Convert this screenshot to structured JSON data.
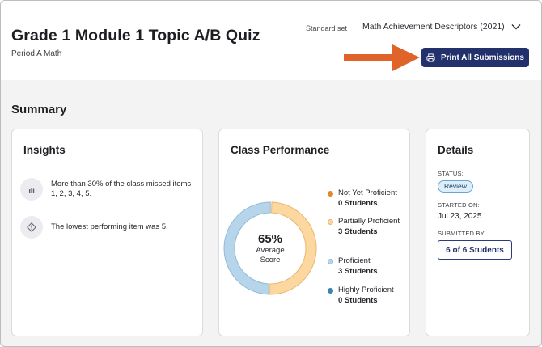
{
  "header": {
    "title": "Grade 1 Module 1 Topic A/B Quiz",
    "subtitle": "Period A Math",
    "standard_set_label": "Standard set",
    "standard_set_value": "Math Achievement Descriptors (2021)",
    "print_button_label": "Print All Submissions",
    "arrow_color": "#e0642a"
  },
  "summary": {
    "heading": "Summary"
  },
  "insights": {
    "title": "Insights",
    "items": [
      {
        "icon": "bar-chart-icon",
        "text": "More than 30% of the class missed items 1, 2, 3, 4, 5."
      },
      {
        "icon": "warning-diamond-icon",
        "text": "The lowest performing item was 5."
      }
    ]
  },
  "class_performance": {
    "title": "Class Performance",
    "average_value": "65%",
    "average_label": "Average Score",
    "legend": [
      {
        "label": "Not Yet Proficient",
        "count": "0 Students",
        "students": 0,
        "color": "#e08a2c"
      },
      {
        "label": "Partially Proficient",
        "count": "3 Students",
        "students": 3,
        "color": "#fcd79f"
      },
      {
        "label": "Proficient",
        "count": "3 Students",
        "students": 3,
        "color": "#b7d5ea"
      },
      {
        "label": "Highly Proficient",
        "count": "0 Students",
        "students": 0,
        "color": "#3c83b5"
      }
    ]
  },
  "details": {
    "title": "Details",
    "status_label": "STATUS:",
    "status_value": "Review",
    "started_label": "STARTED ON:",
    "started_value": "Jul 23, 2025",
    "submitted_label": "SUBMITTED BY:",
    "submitted_value": "6 of 6 Students"
  }
}
